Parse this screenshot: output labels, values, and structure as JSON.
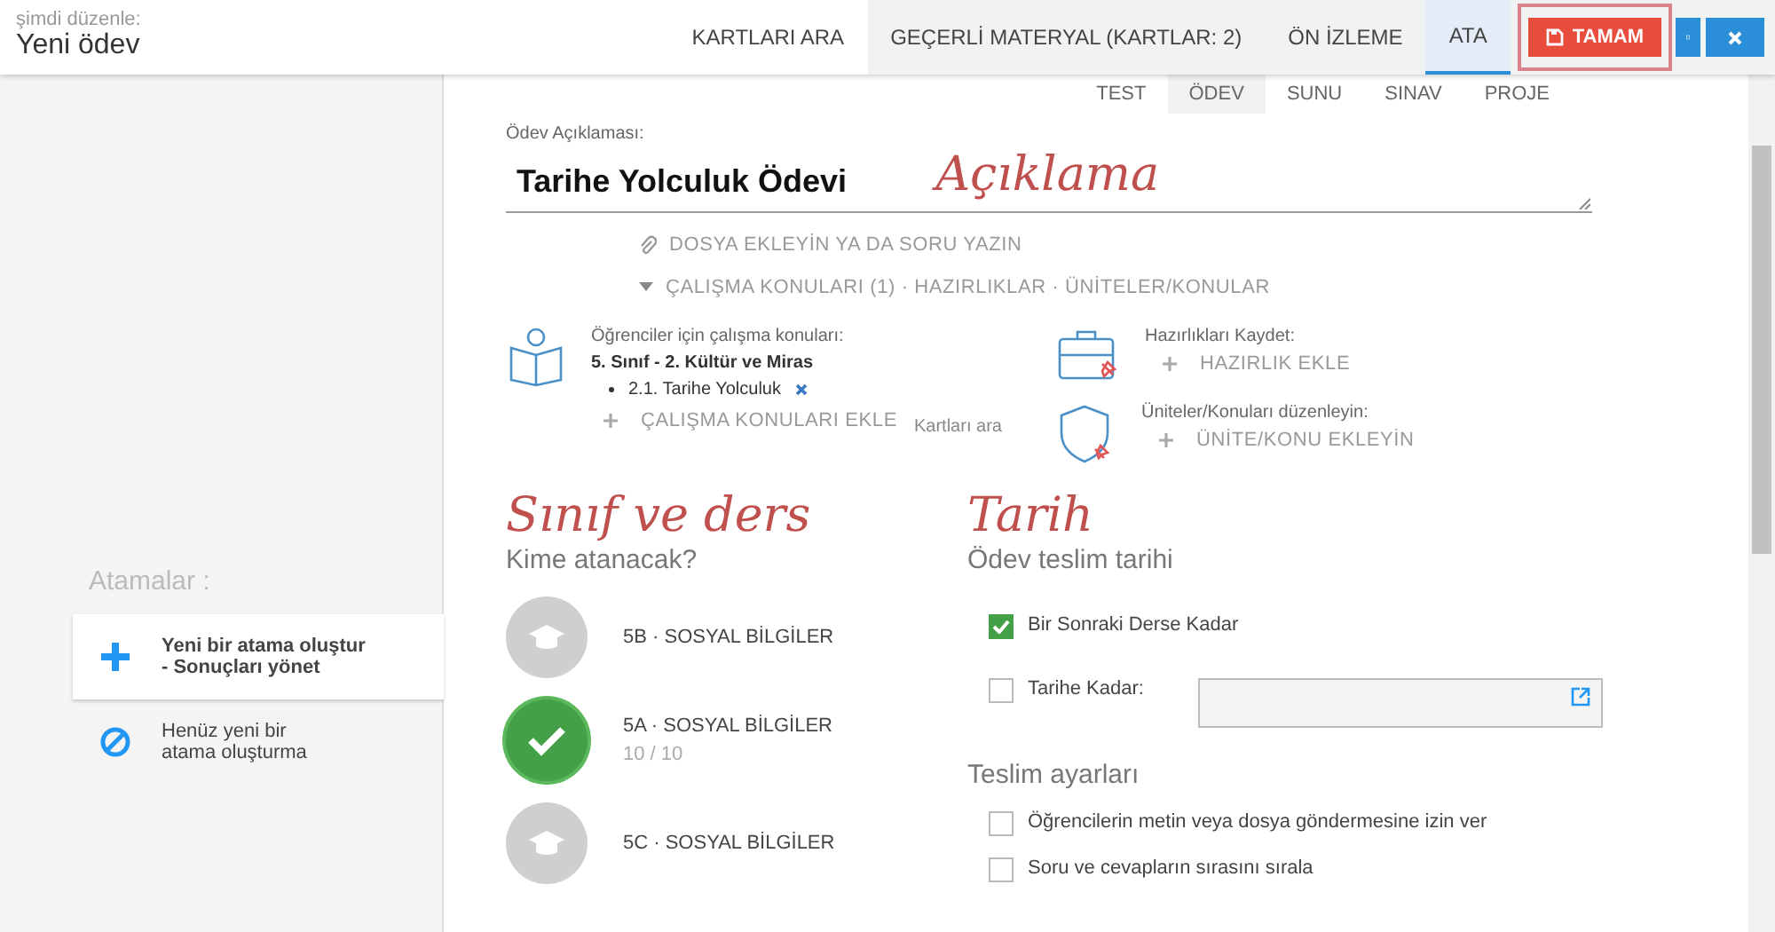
{
  "header": {
    "caption": "şimdi düzenle:",
    "title": "Yeni ödev"
  },
  "tabs": [
    {
      "label": "KARTLARI ARA",
      "selected": false
    },
    {
      "label": "GEÇERLİ MATERYAL (KARTLAR: 2)",
      "selected": false
    },
    {
      "label": "ÖN İZLEME",
      "selected": false
    },
    {
      "label": "ATA",
      "selected": true
    }
  ],
  "actions": {
    "save": {
      "label": "TAMAM",
      "highlighted": true
    }
  },
  "sidebar": {
    "heading": "Atamalar :",
    "items": [
      {
        "kind": "create",
        "lines": [
          "Yeni bir atama oluştur",
          "- Sonuçları yönet"
        ],
        "selected": true
      },
      {
        "kind": "none",
        "lines": [
          "Henüz yeni bir",
          "atama oluşturma"
        ],
        "selected": false
      }
    ]
  },
  "type_tabs": [
    {
      "label": "TEST",
      "selected": false
    },
    {
      "label": "ÖDEV",
      "selected": true
    },
    {
      "label": "SUNU",
      "selected": false
    },
    {
      "label": "SINAV",
      "selected": false
    },
    {
      "label": "PROJE",
      "selected": false
    }
  ],
  "description": {
    "label": "Ödev Açıklaması:",
    "value": "Tarihe Yolculuk Ödevi",
    "annotation": "Açıklama"
  },
  "attach_link": "DOSYA EKLEYİN YA DA SORU YAZIN",
  "sections_toggle": {
    "label": "ÇALIŞMA KONULARI (1) · HAZIRLIKLAR · ÜNİTELER/KONULAR",
    "expanded": true
  },
  "study": {
    "label": "Öğrenciler için çalışma konuları:",
    "group": "5. Sınıf - 2. Kültür ve Miras",
    "topics": [
      "2.1. Tarihe Yolculuk"
    ],
    "add": "ÇALIŞMA KONULARI EKLE"
  },
  "search_cards": "Kartları ara",
  "prep": {
    "label": "Hazırlıkları Kaydet:",
    "add": "HAZIRLIK EKLE"
  },
  "units": {
    "label": "Üniteler/Konuları düzenleyin:",
    "add": "ÜNİTE/KONU EKLEYİN"
  },
  "recipients": {
    "annotation": "Sınıf ve ders",
    "heading": "Kime atanacak?",
    "classes": [
      {
        "name": "5B · SOSYAL BİLGİLER",
        "selected": false
      },
      {
        "name": "5A · SOSYAL BİLGİLER",
        "count": "10 / 10",
        "selected": true
      },
      {
        "name": "5C · SOSYAL BİLGİLER",
        "selected": false
      }
    ]
  },
  "due": {
    "annotation": "Tarih",
    "heading": "Ödev teslim tarihi",
    "options": [
      {
        "kind": "check",
        "label": "Bir Sonraki Derse Kadar",
        "checked": true
      },
      {
        "kind": "date",
        "label": "Tarihe Kadar:",
        "checked": false
      }
    ]
  },
  "delivery": {
    "heading": "Teslim ayarları",
    "options": [
      {
        "label": "Öğrencilerin metin veya dosya göndermesine izin ver",
        "checked": false
      },
      {
        "label": "Soru ve cevapların sırasını sırala",
        "checked": false
      }
    ]
  }
}
